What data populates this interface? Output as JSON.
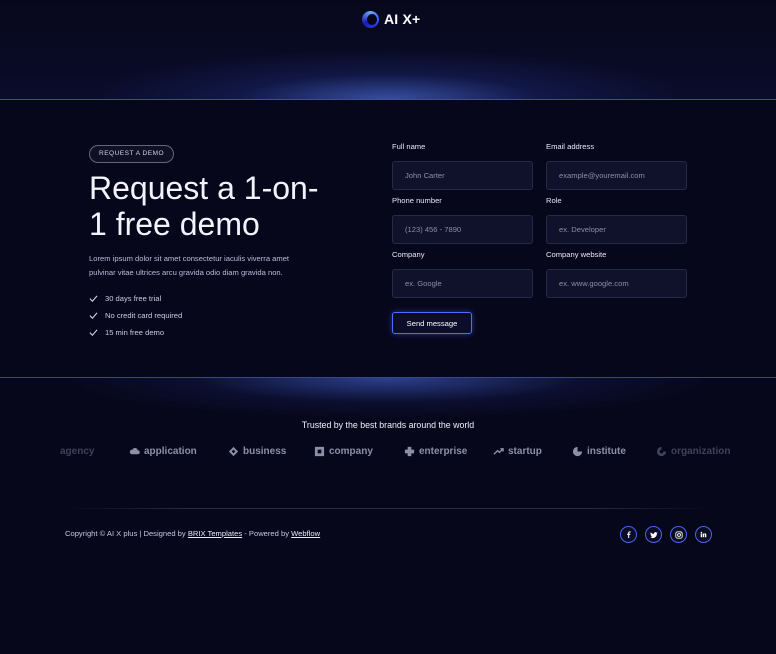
{
  "header": {
    "logo_text": "AI X+"
  },
  "hero": {
    "badge": "REQUEST A DEMO",
    "title": "Request a 1-on-1 free demo",
    "description": "Lorem ipsum dolor sit amet consectetur iaculis viverra amet pulvinar vitae ultrices arcu gravida odio diam gravida non.",
    "features": [
      "30 days free trial",
      "No credit card required",
      "15 min free demo"
    ]
  },
  "form": {
    "full_name": {
      "label": "Full name",
      "placeholder": "John Carter"
    },
    "email": {
      "label": "Email address",
      "placeholder": "example@youremail.com"
    },
    "phone": {
      "label": "Phone number",
      "placeholder": "(123) 456 - 7890"
    },
    "role": {
      "label": "Role",
      "placeholder": "ex. Developer"
    },
    "company": {
      "label": "Company",
      "placeholder": "ex. Google"
    },
    "website": {
      "label": "Company website",
      "placeholder": "ex. www.google.com"
    },
    "submit_label": "Send message"
  },
  "trusted": {
    "title": "Trusted by the best brands around the world",
    "brands": [
      "agency",
      "application",
      "business",
      "company",
      "enterprise",
      "startup",
      "institute",
      "organization"
    ]
  },
  "footer": {
    "copyright": "Copyright © AI X plus | Designed by",
    "designer_link": "BRIX Templates",
    "powered_by": "- Powered by",
    "platform_link": "Webflow",
    "socials": [
      "facebook",
      "twitter",
      "instagram",
      "linkedin"
    ]
  },
  "colors": {
    "background": "#07071c",
    "accent": "#4c6fff",
    "glow": "#5a82ff"
  }
}
